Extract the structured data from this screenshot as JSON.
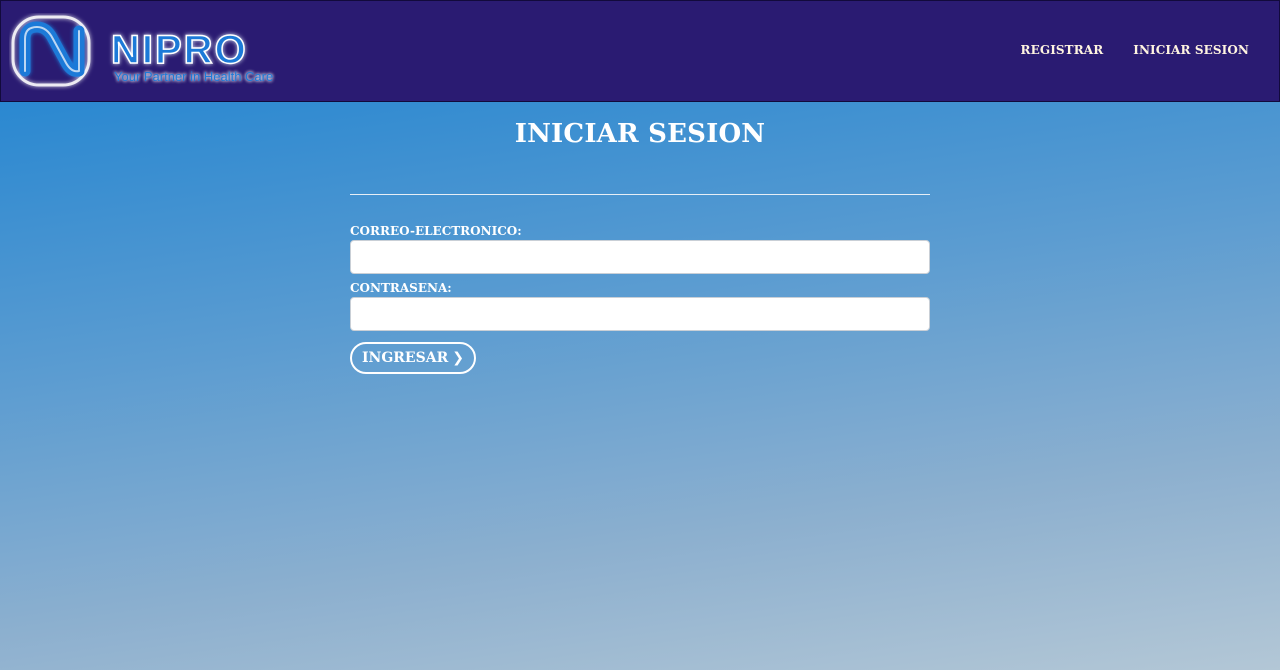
{
  "brand": {
    "logo_text": "NIPRO",
    "tagline": "Your Partner in Health Care",
    "logo_icon": "nipro-logo-mark"
  },
  "nav": {
    "items": [
      {
        "label": "REGISTRAR"
      },
      {
        "label": "INICIAR SESION"
      }
    ]
  },
  "page": {
    "title": "INICIAR SESION"
  },
  "form": {
    "email_label": "CORREO-ELECTRONICO:",
    "email_value": "",
    "password_label": "CONTRASENA:",
    "password_value": "",
    "submit_label": "INGRESAR",
    "submit_icon": "chevron-right-icon"
  },
  "colors": {
    "header_bg": "#2a1b72",
    "brand_blue": "#1e7ad8",
    "text_light": "#ffffff"
  }
}
